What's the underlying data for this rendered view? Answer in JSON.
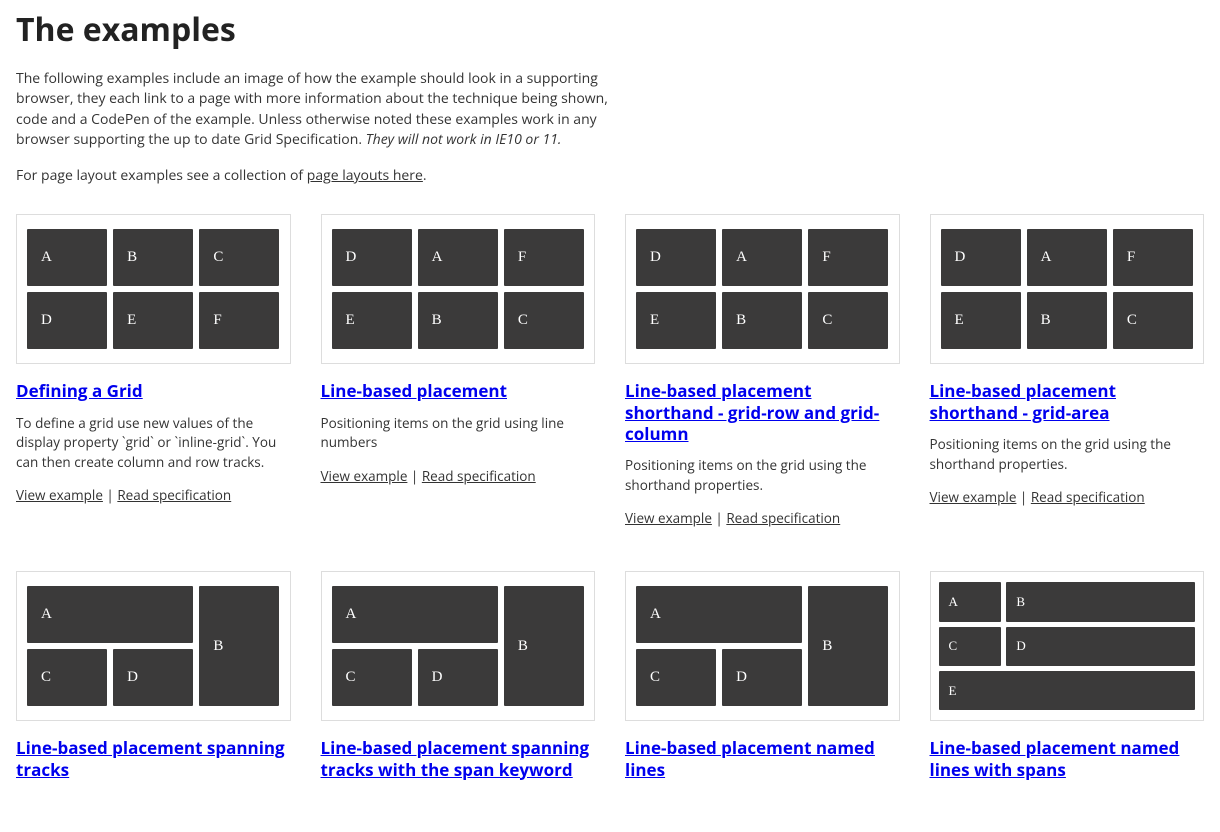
{
  "heading": "The examples",
  "intro": {
    "p1_a": "The following examples include an image of how the example should look in a supporting browser, they each link to a page with more information about the technique being shown, code and a CodePen of the example. Unless otherwise noted these examples work in any browser supporting the up to date Grid Specification. ",
    "p1_em": "They will not work in IE10 or 11.",
    "p2_a": "For page layout examples see a collection of ",
    "p2_link": "page layouts here",
    "p2_b": "."
  },
  "labels": {
    "view": "View example",
    "spec": "Read specification",
    "sep": " | "
  },
  "cards": {
    "c1": {
      "title": "Defining a Grid",
      "desc": "To define a grid use new values of the display property `grid` or `inline-grid`. You can then create column and row tracks.",
      "cells": [
        "A",
        "B",
        "C",
        "D",
        "E",
        "F"
      ]
    },
    "c2": {
      "title": "Line-based placement",
      "desc": "Positioning items on the grid using line numbers",
      "cells": [
        "D",
        "A",
        "F",
        "E",
        "B",
        "C"
      ]
    },
    "c3": {
      "title": "Line-based placement shorthand - grid-row and grid-column",
      "desc": "Positioning items on the grid using the shorthand properties.",
      "cells": [
        "D",
        "A",
        "F",
        "E",
        "B",
        "C"
      ]
    },
    "c4": {
      "title": "Line-based placement shorthand - grid-area",
      "desc": "Positioning items on the grid using the shorthand properties.",
      "cells": [
        "D",
        "A",
        "F",
        "E",
        "B",
        "C"
      ]
    },
    "c5": {
      "title": "Line-based placement spanning tracks",
      "cells": [
        "A",
        "B",
        "C",
        "D"
      ]
    },
    "c6": {
      "title": "Line-based placement spanning tracks with the span keyword",
      "cells": [
        "A",
        "B",
        "C",
        "D"
      ]
    },
    "c7": {
      "title": "Line-based placement named lines",
      "cells": [
        "A",
        "B",
        "C",
        "D"
      ]
    },
    "c8": {
      "title": "Line-based placement named lines with spans",
      "cells": [
        "A",
        "B",
        "C",
        "D",
        "E"
      ]
    }
  }
}
